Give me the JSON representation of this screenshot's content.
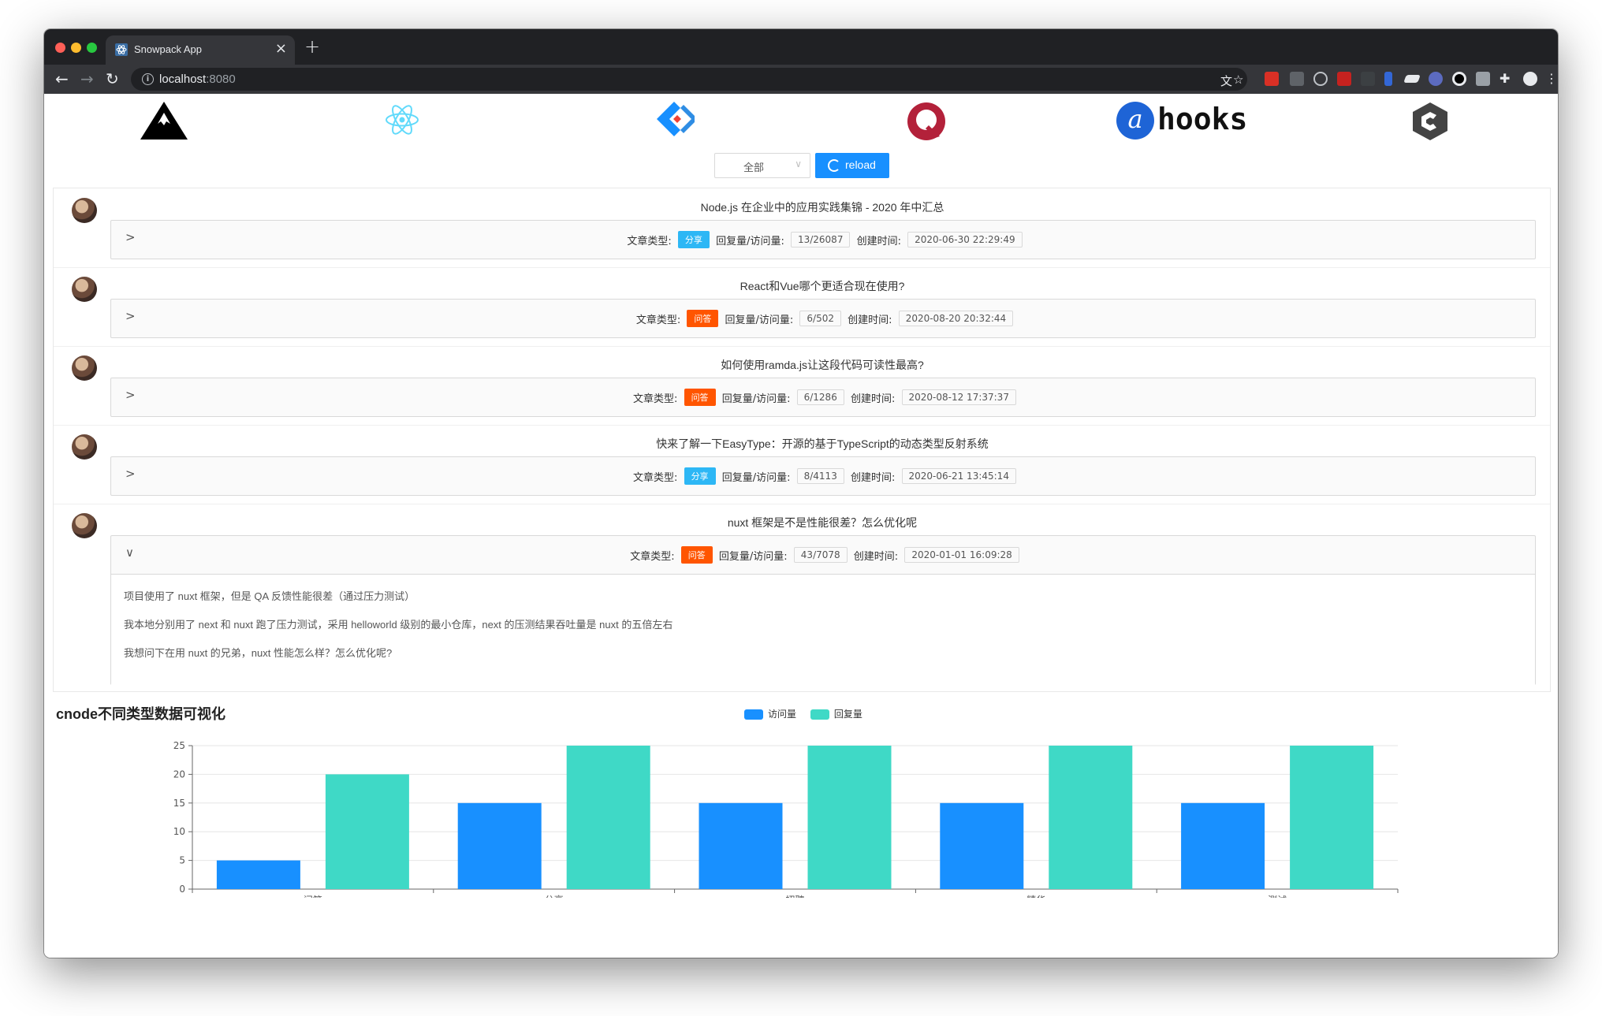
{
  "browser": {
    "tab_title": "Snowpack App",
    "tab_close": "×",
    "new_tab": "+",
    "url_host": "localhost",
    "url_port": ":8080",
    "back": "←",
    "forward": "→",
    "refresh": "↻"
  },
  "header": {
    "logos": [
      "mountain-logo",
      "react-logo",
      "antd-logo",
      "q-logo",
      "ahooks-logo",
      "cnode-logo"
    ],
    "ahooks_text": "hooks",
    "ahooks_badge": "a"
  },
  "controls": {
    "select_value": "全部",
    "select_arrow": "∨",
    "reload_label": "reload"
  },
  "list": {
    "labels": {
      "type": "文章类型:",
      "reply_visit": "回复量/访问量:",
      "created": "创建时间:"
    },
    "items": [
      {
        "title": "Node.js 在企业中的应用实践集锦 - 2020 年中汇总",
        "tag": "分享",
        "tag_kind": "share",
        "counts": "13/26087",
        "created": "2020-06-30 22:29:49",
        "expanded": false,
        "chevron": ">"
      },
      {
        "title": "React和Vue哪个更适合现在使用?",
        "tag": "问答",
        "tag_kind": "ask",
        "counts": "6/502",
        "created": "2020-08-20 20:32:44",
        "expanded": false,
        "chevron": ">"
      },
      {
        "title": "如何使用ramda.js让这段代码可读性最高?",
        "tag": "问答",
        "tag_kind": "ask",
        "counts": "6/1286",
        "created": "2020-08-12 17:37:37",
        "expanded": false,
        "chevron": ">"
      },
      {
        "title": "快来了解一下EasyType：开源的基于TypeScript的动态类型反射系统",
        "tag": "分享",
        "tag_kind": "share",
        "counts": "8/4113",
        "created": "2020-06-21 13:45:14",
        "expanded": false,
        "chevron": ">"
      },
      {
        "title": "nuxt 框架是不是性能很差？怎么优化呢",
        "tag": "问答",
        "tag_kind": "ask",
        "counts": "43/7078",
        "created": "2020-01-01 16:09:28",
        "expanded": true,
        "chevron": "∨",
        "content": [
          "项目使用了 nuxt 框架，但是 QA 反馈性能很差（通过压力测试）",
          "我本地分别用了 next 和 nuxt 跑了压力测试，采用 helloworld 级别的最小仓库，next 的压测结果吞吐量是 nuxt 的五倍左右",
          "我想问下在用 nuxt 的兄弟，nuxt 性能怎么样？怎么优化呢?"
        ]
      }
    ]
  },
  "chart_title": "cnode不同类型数据可视化",
  "colors": {
    "visit": "#1890ff",
    "reply": "#3fd9c6",
    "share_tag": "#2db7f5",
    "ask_tag": "#ff5500",
    "primary": "#1890ff"
  },
  "chart_data": {
    "type": "bar",
    "categories": [
      "问答",
      "分享",
      "招聘",
      "精华",
      "测试"
    ],
    "series": [
      {
        "name": "访问量",
        "values": [
          5,
          15,
          15,
          15,
          15
        ]
      },
      {
        "name": "回复量",
        "values": [
          20,
          25,
          25,
          25,
          25
        ]
      }
    ],
    "ylim": [
      0,
      25
    ],
    "yticks": [
      0,
      5,
      10,
      15,
      20,
      25
    ],
    "grid": true,
    "legend": "top-center"
  }
}
